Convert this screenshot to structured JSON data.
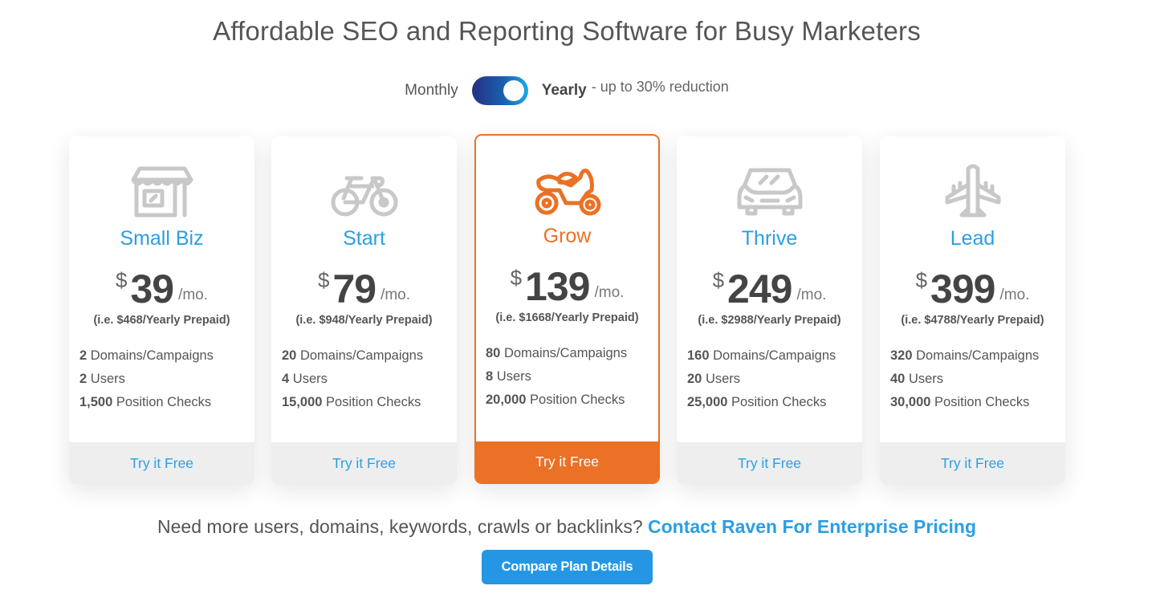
{
  "header": {
    "title": "Affordable SEO and Reporting Software for Busy Marketers"
  },
  "billing": {
    "monthly_label": "Monthly",
    "yearly_label": "Yearly",
    "yearly_note": "- up to 30% reduction",
    "selected": "Yearly"
  },
  "colors": {
    "accent_blue": "#2a9fe4",
    "featured_orange": "#ea7125",
    "icon_gray": "#c8c8c8"
  },
  "plans": [
    {
      "name": "Small Biz",
      "icon": "storefront-icon",
      "currency": "$",
      "price": "39",
      "period": "/mo.",
      "prepaid": "(i.e. $468/Yearly Prepaid)",
      "features": [
        {
          "value": "2",
          "label": " Domains/Campaigns"
        },
        {
          "value": "2",
          "label": " Users"
        },
        {
          "value": "1,500",
          "label": " Position Checks"
        }
      ],
      "cta": "Try it Free",
      "featured": false
    },
    {
      "name": "Start",
      "icon": "bicycle-icon",
      "currency": "$",
      "price": "79",
      "period": "/mo.",
      "prepaid": "(i.e. $948/Yearly Prepaid)",
      "features": [
        {
          "value": "20",
          "label": " Domains/Campaigns"
        },
        {
          "value": "4",
          "label": " Users"
        },
        {
          "value": "15,000",
          "label": " Position Checks"
        }
      ],
      "cta": "Try it Free",
      "featured": false
    },
    {
      "name": "Grow",
      "icon": "motorcycle-icon",
      "currency": "$",
      "price": "139",
      "period": "/mo.",
      "prepaid": "(i.e. $1668/Yearly Prepaid)",
      "features": [
        {
          "value": "80",
          "label": " Domains/Campaigns"
        },
        {
          "value": "8",
          "label": " Users"
        },
        {
          "value": "20,000",
          "label": " Position Checks"
        }
      ],
      "cta": "Try it Free",
      "featured": true
    },
    {
      "name": "Thrive",
      "icon": "car-icon",
      "currency": "$",
      "price": "249",
      "period": "/mo.",
      "prepaid": "(i.e. $2988/Yearly Prepaid)",
      "features": [
        {
          "value": "160",
          "label": " Domains/Campaigns"
        },
        {
          "value": "20",
          "label": " Users"
        },
        {
          "value": "25,000",
          "label": " Position Checks"
        }
      ],
      "cta": "Try it Free",
      "featured": false
    },
    {
      "name": "Lead",
      "icon": "airplane-icon",
      "currency": "$",
      "price": "399",
      "period": "/mo.",
      "prepaid": "(i.e. $4788/Yearly Prepaid)",
      "features": [
        {
          "value": "320",
          "label": " Domains/Campaigns"
        },
        {
          "value": "40",
          "label": " Users"
        },
        {
          "value": "30,000",
          "label": " Position Checks"
        }
      ],
      "cta": "Try it Free",
      "featured": false
    }
  ],
  "footer": {
    "question": "Need more users, domains, keywords, crawls or backlinks? ",
    "enterprise_link": "Contact Raven For Enterprise Pricing",
    "compare_button": "Compare Plan Details"
  }
}
